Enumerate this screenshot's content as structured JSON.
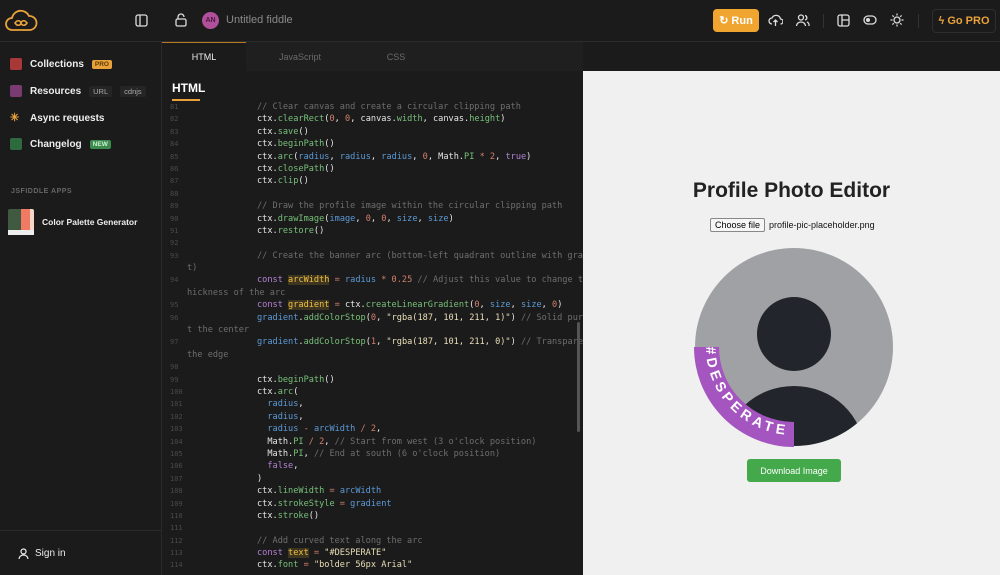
{
  "header": {
    "fiddle_title": "Untitled fiddle",
    "avatar_initials": "AN",
    "run_label": "Run",
    "go_pro_label": "Go PRO"
  },
  "sidebar": {
    "items": [
      {
        "label": "Collections",
        "badge": "PRO"
      },
      {
        "label": "Resources",
        "tags": [
          "URL",
          "cdnjs"
        ]
      },
      {
        "label": "Async requests"
      },
      {
        "label": "Changelog",
        "badge": "NEW"
      }
    ],
    "apps_heading": "JSFIDDLE APPS",
    "apps": [
      {
        "label": "Color Palette Generator"
      }
    ],
    "sign_in": "Sign in"
  },
  "tabs": [
    {
      "label": "HTML"
    },
    {
      "label": "JavaScript"
    },
    {
      "label": "CSS"
    }
  ],
  "editor": {
    "title": "HTML",
    "lines": [
      {
        "n": "81",
        "t": [
          [
            "c",
            "// Clear canvas and create a circular clipping path"
          ]
        ]
      },
      {
        "n": "82",
        "t": [
          [
            "p",
            "ctx."
          ],
          [
            "f",
            "clearRect"
          ],
          [
            "p",
            "("
          ],
          [
            "n",
            "0"
          ],
          [
            "p",
            ", "
          ],
          [
            "n",
            "0"
          ],
          [
            "p",
            ", canvas."
          ],
          [
            "f",
            "width"
          ],
          [
            "p",
            ", canvas."
          ],
          [
            "f",
            "height"
          ],
          [
            "p",
            ")"
          ]
        ]
      },
      {
        "n": "83",
        "t": [
          [
            "p",
            "ctx."
          ],
          [
            "f",
            "save"
          ],
          [
            "p",
            "()"
          ]
        ]
      },
      {
        "n": "84",
        "t": [
          [
            "p",
            "ctx."
          ],
          [
            "f",
            "beginPath"
          ],
          [
            "p",
            "()"
          ]
        ]
      },
      {
        "n": "85",
        "t": [
          [
            "p",
            "ctx."
          ],
          [
            "f",
            "arc"
          ],
          [
            "p",
            "("
          ],
          [
            "v",
            "radius"
          ],
          [
            "p",
            ", "
          ],
          [
            "v",
            "radius"
          ],
          [
            "p",
            ", "
          ],
          [
            "v",
            "radius"
          ],
          [
            "p",
            ", "
          ],
          [
            "n",
            "0"
          ],
          [
            "p",
            ", Math."
          ],
          [
            "f",
            "PI"
          ],
          [
            "n",
            " * 2"
          ],
          [
            "p",
            ", "
          ],
          [
            "k",
            "true"
          ],
          [
            "p",
            ")"
          ]
        ]
      },
      {
        "n": "86",
        "t": [
          [
            "p",
            "ctx."
          ],
          [
            "f",
            "closePath"
          ],
          [
            "p",
            "()"
          ]
        ]
      },
      {
        "n": "87",
        "t": [
          [
            "p",
            "ctx."
          ],
          [
            "f",
            "clip"
          ],
          [
            "p",
            "()"
          ]
        ]
      },
      {
        "n": "88",
        "t": []
      },
      {
        "n": "89",
        "t": [
          [
            "c",
            "// Draw the profile image within the circular clipping path"
          ]
        ]
      },
      {
        "n": "90",
        "t": [
          [
            "p",
            "ctx."
          ],
          [
            "f",
            "drawImage"
          ],
          [
            "p",
            "("
          ],
          [
            "v",
            "image"
          ],
          [
            "p",
            ", "
          ],
          [
            "n",
            "0"
          ],
          [
            "p",
            ", "
          ],
          [
            "n",
            "0"
          ],
          [
            "p",
            ", "
          ],
          [
            "v",
            "size"
          ],
          [
            "p",
            ", "
          ],
          [
            "v",
            "size"
          ],
          [
            "p",
            ")"
          ]
        ]
      },
      {
        "n": "91",
        "t": [
          [
            "p",
            "ctx."
          ],
          [
            "f",
            "restore"
          ],
          [
            "p",
            "()"
          ]
        ]
      },
      {
        "n": "92",
        "t": []
      },
      {
        "n": "93",
        "t": [
          [
            "c",
            "// Create the banner arc (bottom-left quadrant outline with gradie"
          ]
        ]
      },
      {
        "n": "",
        "t": [
          [
            "c",
            "t)"
          ]
        ]
      },
      {
        "n": "94",
        "t": [
          [
            "k",
            "const "
          ],
          [
            "h",
            "arcWidth"
          ],
          [
            "n",
            " = "
          ],
          [
            "v",
            "radius"
          ],
          [
            "n",
            " * 0.25"
          ],
          [
            "c",
            " // Adjust this value to change the"
          ]
        ]
      },
      {
        "n": "",
        "t": [
          [
            "c",
            "hickness of the arc"
          ]
        ]
      },
      {
        "n": "95",
        "t": [
          [
            "k",
            "const "
          ],
          [
            "h",
            "gradient"
          ],
          [
            "n",
            " = "
          ],
          [
            "p",
            "ctx."
          ],
          [
            "f",
            "createLinearGradient"
          ],
          [
            "p",
            "("
          ],
          [
            "n",
            "0"
          ],
          [
            "p",
            ", "
          ],
          [
            "v",
            "size"
          ],
          [
            "p",
            ", "
          ],
          [
            "v",
            "size"
          ],
          [
            "p",
            ", "
          ],
          [
            "n",
            "0"
          ],
          [
            "p",
            ")"
          ]
        ]
      },
      {
        "n": "96",
        "t": [
          [
            "v",
            "gradient"
          ],
          [
            "p",
            "."
          ],
          [
            "f",
            "addColorStop"
          ],
          [
            "p",
            "("
          ],
          [
            "n",
            "0"
          ],
          [
            "p",
            ", "
          ],
          [
            "s",
            "\"rgba(187, 101, 211, 1)\""
          ],
          [
            "p",
            ") "
          ],
          [
            "c",
            "// Solid purple"
          ]
        ]
      },
      {
        "n": "",
        "t": [
          [
            "c",
            "t the center"
          ]
        ]
      },
      {
        "n": "97",
        "t": [
          [
            "v",
            "gradient"
          ],
          [
            "p",
            "."
          ],
          [
            "f",
            "addColorStop"
          ],
          [
            "p",
            "("
          ],
          [
            "n",
            "1"
          ],
          [
            "p",
            ", "
          ],
          [
            "s",
            "\"rgba(187, 101, 211, 0)\""
          ],
          [
            "p",
            ") "
          ],
          [
            "c",
            "// Transparent"
          ]
        ]
      },
      {
        "n": "",
        "t": [
          [
            "c",
            "the edge"
          ]
        ]
      },
      {
        "n": "98",
        "t": []
      },
      {
        "n": "99",
        "t": [
          [
            "p",
            "ctx."
          ],
          [
            "f",
            "beginPath"
          ],
          [
            "p",
            "()"
          ]
        ]
      },
      {
        "n": "100",
        "t": [
          [
            "p",
            "ctx."
          ],
          [
            "f",
            "arc"
          ],
          [
            "p",
            "("
          ]
        ]
      },
      {
        "n": "101",
        "t": [
          [
            "p",
            "  "
          ],
          [
            "v",
            "radius"
          ],
          [
            "p",
            ","
          ]
        ]
      },
      {
        "n": "102",
        "t": [
          [
            "p",
            "  "
          ],
          [
            "v",
            "radius"
          ],
          [
            "p",
            ","
          ]
        ]
      },
      {
        "n": "103",
        "t": [
          [
            "p",
            "  "
          ],
          [
            "v",
            "radius"
          ],
          [
            "n",
            " - "
          ],
          [
            "v",
            "arcWidth"
          ],
          [
            "n",
            " / 2"
          ],
          [
            "p",
            ","
          ]
        ]
      },
      {
        "n": "104",
        "t": [
          [
            "p",
            "  Math."
          ],
          [
            "f",
            "PI"
          ],
          [
            "n",
            " / 2"
          ],
          [
            "p",
            ", "
          ],
          [
            "c",
            "// Start from west (3 o'clock position)"
          ]
        ]
      },
      {
        "n": "105",
        "t": [
          [
            "p",
            "  Math."
          ],
          [
            "f",
            "PI"
          ],
          [
            "p",
            ", "
          ],
          [
            "c",
            "// End at south (6 o'clock position)"
          ]
        ]
      },
      {
        "n": "106",
        "t": [
          [
            "p",
            "  "
          ],
          [
            "k",
            "false"
          ],
          [
            "p",
            ","
          ]
        ]
      },
      {
        "n": "107",
        "t": [
          [
            "p",
            ")"
          ]
        ]
      },
      {
        "n": "108",
        "t": [
          [
            "p",
            "ctx."
          ],
          [
            "f",
            "lineWidth"
          ],
          [
            "n",
            " = "
          ],
          [
            "v",
            "arcWidth"
          ]
        ]
      },
      {
        "n": "109",
        "t": [
          [
            "p",
            "ctx."
          ],
          [
            "f",
            "strokeStyle"
          ],
          [
            "n",
            " = "
          ],
          [
            "v",
            "gradient"
          ]
        ]
      },
      {
        "n": "110",
        "t": [
          [
            "p",
            "ctx."
          ],
          [
            "f",
            "stroke"
          ],
          [
            "p",
            "()"
          ]
        ]
      },
      {
        "n": "111",
        "t": []
      },
      {
        "n": "112",
        "t": [
          [
            "c",
            "// Add curved text along the arc"
          ]
        ]
      },
      {
        "n": "113",
        "t": [
          [
            "k",
            "const "
          ],
          [
            "h",
            "text"
          ],
          [
            "n",
            " = "
          ],
          [
            "s",
            "\"#DESPERATE\""
          ]
        ]
      },
      {
        "n": "114",
        "t": [
          [
            "p",
            "ctx."
          ],
          [
            "f",
            "font"
          ],
          [
            "n",
            " = "
          ],
          [
            "s",
            "\"bolder 56px Arial\""
          ]
        ]
      }
    ]
  },
  "preview": {
    "title": "Profile Photo Editor",
    "choose_file_label": "Choose file",
    "file_name": "profile-pic-placeholder.png",
    "banner_text": "#DESPERATE",
    "download_label": "Download Image"
  },
  "colors": {
    "accent": "#f0a531",
    "banner": "#bb65d3",
    "download": "#43a94a"
  }
}
